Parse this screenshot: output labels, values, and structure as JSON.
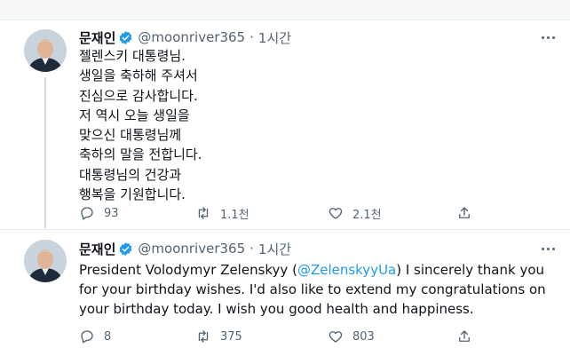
{
  "tweets": [
    {
      "author_name": "문재인",
      "handle": "@moonriver365",
      "separator": "·",
      "time": "1시간",
      "text": "젤렌스키 대통령님.\n생일을 축하해 주셔서\n진심으로 감사합니다.\n저 역시 오늘 생일을\n맞으신 대통령님께\n축하의 말을 전합니다.\n대통령님의 건강과\n행복을 기원합니다.",
      "reply_count": "93",
      "retweet_count": "1.1천",
      "like_count": "2.1천"
    },
    {
      "author_name": "문재인",
      "handle": "@moonriver365",
      "separator": "·",
      "time": "1시간",
      "text_before": "President Volodymyr Zelenskyy (",
      "mention": "@ZelenskyyUa",
      "text_after": ") I sincerely thank you for your birthday wishes. I'd also like to extend my congratulations on your birthday today. I wish you good health and happiness.",
      "reply_count": "8",
      "retweet_count": "375",
      "like_count": "803"
    }
  ],
  "colors": {
    "accent": "#1d9bf0",
    "muted": "#536471",
    "text": "#0f1419",
    "divider": "#e6ecf0"
  },
  "icons": [
    "verified-badge-icon",
    "more-options-icon",
    "reply-icon",
    "retweet-icon",
    "like-icon",
    "share-icon"
  ]
}
